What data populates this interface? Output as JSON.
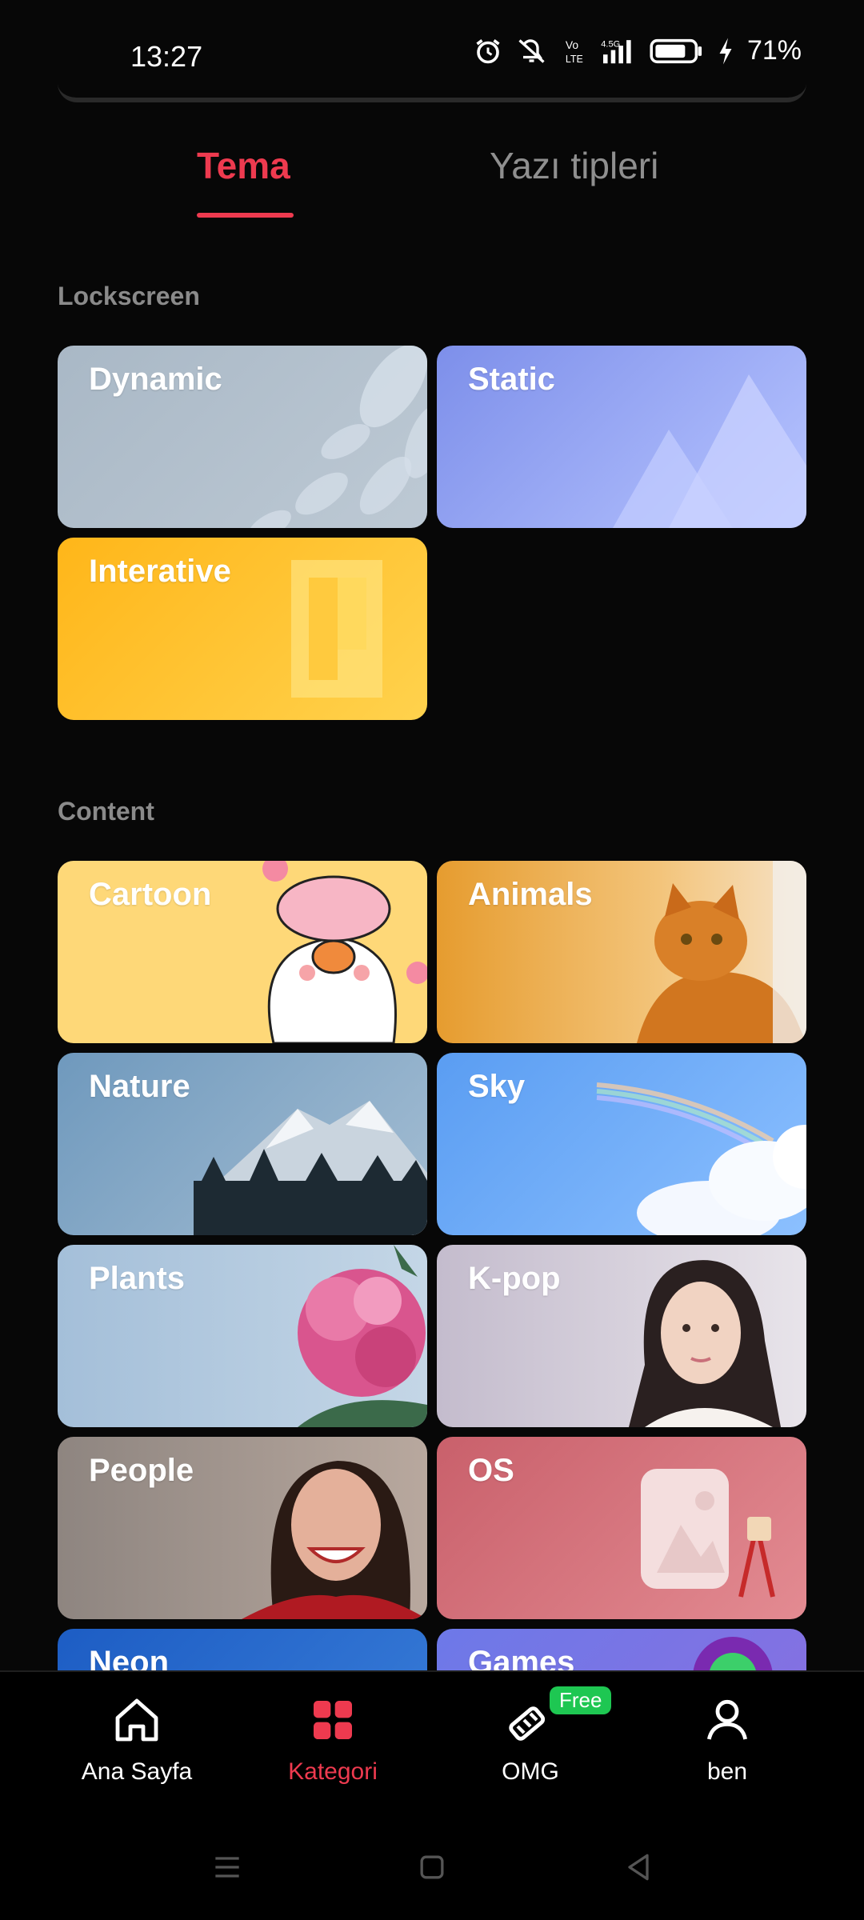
{
  "status_bar": {
    "time": "13:27",
    "battery_percent": "71%",
    "icons": [
      "alarm-icon",
      "mute-icon",
      "volte-icon",
      "signal-icon",
      "battery-icon",
      "charging-icon"
    ]
  },
  "tabs": [
    {
      "label": "Tema",
      "active": true
    },
    {
      "label": "Yazı tipleri",
      "active": false
    }
  ],
  "lockscreen": {
    "title": "Lockscreen",
    "cards": [
      {
        "label": "Dynamic",
        "color": "#b3c0cc"
      },
      {
        "label": "Static",
        "color": "#8d9cf0"
      },
      {
        "label": "Interative",
        "color": "#ffc52b"
      }
    ]
  },
  "content": {
    "title": "Content",
    "cards": [
      {
        "label": "Cartoon",
        "color": "#fed878"
      },
      {
        "label": "Animals",
        "color": "#eeaa3e"
      },
      {
        "label": "Nature",
        "color": "#7fa3c2"
      },
      {
        "label": "Sky",
        "color": "#6aa9f5"
      },
      {
        "label": "Plants",
        "color": "#a9c3de"
      },
      {
        "label": "K-pop",
        "color": "#cfc8d4"
      },
      {
        "label": "People",
        "color": "#8d8480"
      },
      {
        "label": "OS",
        "color": "#d9767e"
      },
      {
        "label": "Neon",
        "color": "#2a6fcf"
      },
      {
        "label": "Games",
        "color": "#6d79e8"
      }
    ]
  },
  "bottom_nav": {
    "items": [
      {
        "label": "Ana Sayfa",
        "icon": "home-icon",
        "active": false
      },
      {
        "label": "Kategori",
        "icon": "grid-icon",
        "active": true
      },
      {
        "label": "OMG",
        "icon": "brush-icon",
        "active": false,
        "badge": "Free"
      },
      {
        "label": "ben",
        "icon": "person-icon",
        "active": false
      }
    ]
  },
  "colors": {
    "accent": "#ee3a4f",
    "badge": "#1ec752"
  }
}
